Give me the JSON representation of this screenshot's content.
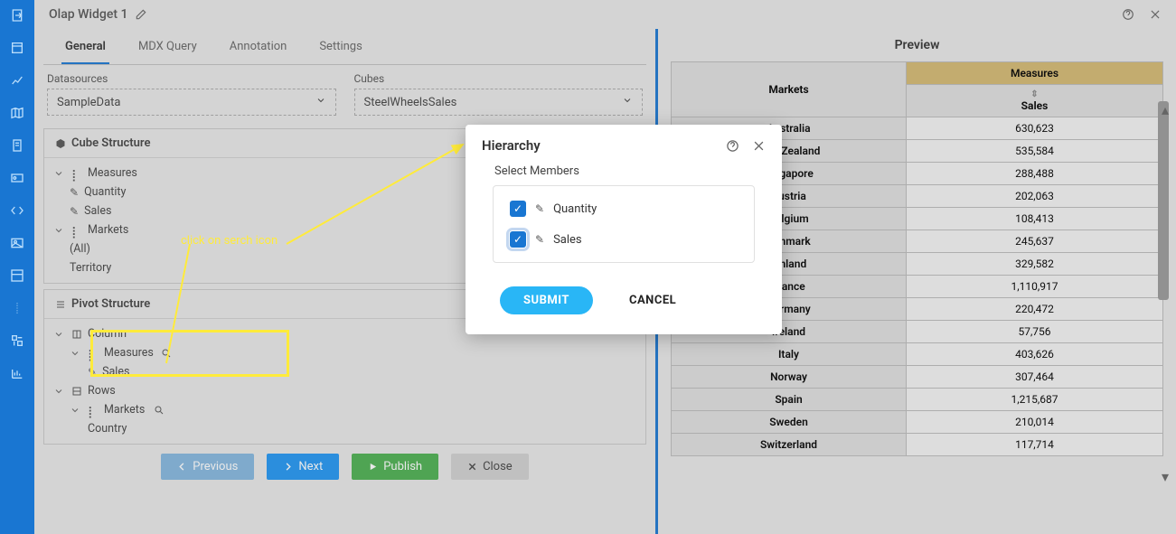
{
  "header": {
    "title": "Olap Widget 1"
  },
  "tabs": [
    "General",
    "MDX Query",
    "Annotation",
    "Settings"
  ],
  "selectors": {
    "datasources": {
      "label": "Datasources",
      "value": "SampleData"
    },
    "cubes": {
      "label": "Cubes",
      "value": "SteelWheelsSales"
    }
  },
  "cube_structure": {
    "title": "Cube Structure",
    "measures": {
      "label": "Measures",
      "items": [
        "Quantity",
        "Sales"
      ]
    },
    "markets": {
      "label": "Markets",
      "items": [
        "(All)",
        "Territory"
      ]
    }
  },
  "pivot_structure": {
    "title": "Pivot Structure",
    "column": {
      "label": "Column",
      "measures": "Measures",
      "items": [
        "Sales"
      ]
    },
    "rows": {
      "label": "Rows",
      "markets": "Markets",
      "items": [
        "Country"
      ]
    }
  },
  "annotation": {
    "text": "click on serch icon"
  },
  "footer": {
    "previous": "Previous",
    "next": "Next",
    "publish": "Publish",
    "close": "Close"
  },
  "preview": {
    "title": "Preview",
    "measures_header": "Measures",
    "markets_header": "Markets",
    "sales_header": "Sales",
    "rows": [
      {
        "label": "Australia",
        "value": "630,623"
      },
      {
        "label": "New Zealand",
        "value": "535,584"
      },
      {
        "label": "Singapore",
        "value": "288,488"
      },
      {
        "label": "Austria",
        "value": "202,063"
      },
      {
        "label": "Belgium",
        "value": "108,413"
      },
      {
        "label": "Denmark",
        "value": "245,637"
      },
      {
        "label": "Finland",
        "value": "329,582"
      },
      {
        "label": "France",
        "value": "1,110,917"
      },
      {
        "label": "Germany",
        "value": "220,472"
      },
      {
        "label": "Ireland",
        "value": "57,756"
      },
      {
        "label": "Italy",
        "value": "403,626"
      },
      {
        "label": "Norway",
        "value": "307,464"
      },
      {
        "label": "Spain",
        "value": "1,215,687"
      },
      {
        "label": "Sweden",
        "value": "210,014"
      },
      {
        "label": "Switzerland",
        "value": "117,714"
      }
    ]
  },
  "dialog": {
    "title": "Hierarchy",
    "subtitle": "Select Members",
    "members": [
      "Quantity",
      "Sales"
    ],
    "submit": "SUBMIT",
    "cancel": "CANCEL"
  }
}
